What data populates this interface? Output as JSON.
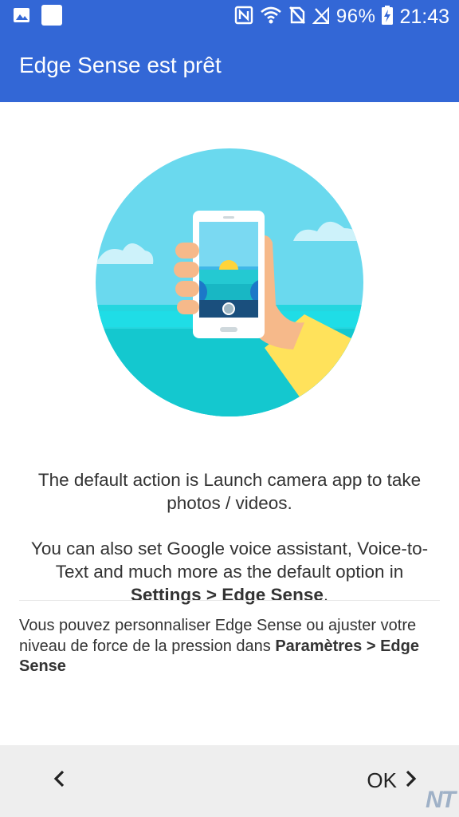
{
  "status_bar": {
    "battery": "96%",
    "time": "21:43",
    "icons": [
      "image-icon",
      "app-icon",
      "nfc-icon",
      "wifi-icon",
      "no-sim-icon",
      "signal-icon",
      "battery-charging-icon"
    ]
  },
  "app_bar": {
    "title": "Edge Sense est prêt"
  },
  "illustration": {
    "name": "hand-holding-phone-camera",
    "colors": {
      "sky": "#6ad9ee",
      "sea": "#1fcad3",
      "hand": "#f6b98a",
      "sleeve": "#ffe25b",
      "phone": "#ffffff",
      "sun": "#ffd43b"
    }
  },
  "content": {
    "line1": "The default action is Launch camera app to take photos / videos.",
    "line2_prefix": "You can also set Google voice assistant, Voice-to-Text and much more as the default option in ",
    "line2_bold": "Settings > Edge Sense",
    "line2_suffix": ".",
    "note_prefix": "Vous pouvez personnaliser Edge Sense ou ajuster votre niveau de force de la pression dans ",
    "note_bold": "Paramètres > Edge Sense"
  },
  "bottom_bar": {
    "back_icon": "chevron-left-icon",
    "ok_label": "OK",
    "ok_icon": "chevron-right-icon"
  },
  "watermark": "NT"
}
